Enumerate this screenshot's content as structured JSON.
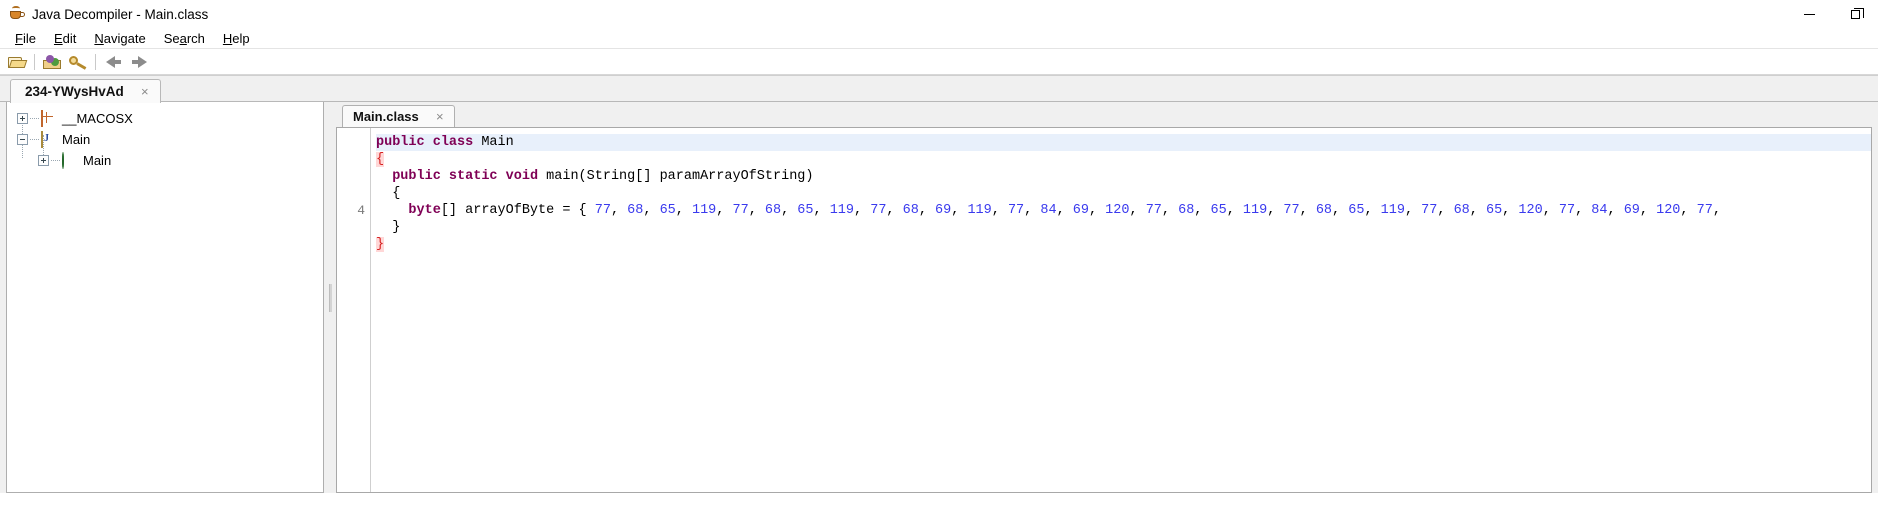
{
  "window": {
    "title": "Java Decompiler - Main.class",
    "icon": "java-cup-icon",
    "controls": {
      "minimize": "minimize-button",
      "maximize": "restore-button"
    }
  },
  "menubar": {
    "items": [
      {
        "label": "File",
        "mnemonic": "F"
      },
      {
        "label": "Edit",
        "mnemonic": "E"
      },
      {
        "label": "Navigate",
        "mnemonic": "N"
      },
      {
        "label": "Search",
        "mnemonic": "a"
      },
      {
        "label": "Help",
        "mnemonic": "H"
      }
    ]
  },
  "toolbar": {
    "buttons": [
      {
        "name": "open-file-button",
        "icon": "open-folder-icon"
      },
      {
        "name": "open-type-button",
        "icon": "package-icon"
      },
      {
        "name": "search-button",
        "icon": "key-icon"
      },
      {
        "name": "navigate-back-button",
        "icon": "arrow-left-icon"
      },
      {
        "name": "navigate-forward-button",
        "icon": "arrow-right-icon"
      }
    ]
  },
  "project_tabs": [
    {
      "label": "234-YWysHvAd",
      "active": true,
      "close": "×"
    }
  ],
  "tree": {
    "nodes": [
      {
        "label": "__MACOSX",
        "icon": "package-grid-icon",
        "expanded": false,
        "toggle": "+",
        "depth": 0
      },
      {
        "label": "Main",
        "icon": "java-file-icon",
        "expanded": true,
        "toggle": "−",
        "depth": 0
      },
      {
        "label": "Main",
        "icon": "java-class-icon",
        "expanded": false,
        "toggle": "+",
        "depth": 1
      }
    ]
  },
  "editor": {
    "tabs": [
      {
        "label": "Main.class",
        "active": true,
        "close": "×"
      }
    ],
    "gutter": [
      "",
      "",
      "",
      "",
      "4",
      "",
      ""
    ],
    "code_lines": [
      {
        "current": true,
        "tokens": [
          {
            "t": "public",
            "c": "kw"
          },
          {
            "t": " ",
            "c": "plain"
          },
          {
            "t": "class",
            "c": "kw"
          },
          {
            "t": " Main",
            "c": "plain"
          }
        ]
      },
      {
        "current": false,
        "tokens": [
          {
            "t": "{",
            "c": "brace-hl"
          }
        ]
      },
      {
        "current": false,
        "tokens": [
          {
            "t": "  ",
            "c": "plain"
          },
          {
            "t": "public",
            "c": "kw"
          },
          {
            "t": " ",
            "c": "plain"
          },
          {
            "t": "static",
            "c": "kw"
          },
          {
            "t": " ",
            "c": "plain"
          },
          {
            "t": "void",
            "c": "kw"
          },
          {
            "t": " main(String[] paramArrayOfString)",
            "c": "plain"
          }
        ]
      },
      {
        "current": false,
        "tokens": [
          {
            "t": "  {",
            "c": "plain"
          }
        ]
      },
      {
        "current": false,
        "tokens": [
          {
            "t": "    ",
            "c": "plain"
          },
          {
            "t": "byte",
            "c": "kw"
          },
          {
            "t": "[] arrayOfByte = { ",
            "c": "plain"
          },
          {
            "t": "77",
            "c": "num"
          },
          {
            "t": ", ",
            "c": "plain"
          },
          {
            "t": "68",
            "c": "num"
          },
          {
            "t": ", ",
            "c": "plain"
          },
          {
            "t": "65",
            "c": "num"
          },
          {
            "t": ", ",
            "c": "plain"
          },
          {
            "t": "119",
            "c": "num"
          },
          {
            "t": ", ",
            "c": "plain"
          },
          {
            "t": "77",
            "c": "num"
          },
          {
            "t": ", ",
            "c": "plain"
          },
          {
            "t": "68",
            "c": "num"
          },
          {
            "t": ", ",
            "c": "plain"
          },
          {
            "t": "65",
            "c": "num"
          },
          {
            "t": ", ",
            "c": "plain"
          },
          {
            "t": "119",
            "c": "num"
          },
          {
            "t": ", ",
            "c": "plain"
          },
          {
            "t": "77",
            "c": "num"
          },
          {
            "t": ", ",
            "c": "plain"
          },
          {
            "t": "68",
            "c": "num"
          },
          {
            "t": ", ",
            "c": "plain"
          },
          {
            "t": "69",
            "c": "num"
          },
          {
            "t": ", ",
            "c": "plain"
          },
          {
            "t": "119",
            "c": "num"
          },
          {
            "t": ", ",
            "c": "plain"
          },
          {
            "t": "77",
            "c": "num"
          },
          {
            "t": ", ",
            "c": "plain"
          },
          {
            "t": "84",
            "c": "num"
          },
          {
            "t": ", ",
            "c": "plain"
          },
          {
            "t": "69",
            "c": "num"
          },
          {
            "t": ", ",
            "c": "plain"
          },
          {
            "t": "120",
            "c": "num"
          },
          {
            "t": ", ",
            "c": "plain"
          },
          {
            "t": "77",
            "c": "num"
          },
          {
            "t": ", ",
            "c": "plain"
          },
          {
            "t": "68",
            "c": "num"
          },
          {
            "t": ", ",
            "c": "plain"
          },
          {
            "t": "65",
            "c": "num"
          },
          {
            "t": ", ",
            "c": "plain"
          },
          {
            "t": "119",
            "c": "num"
          },
          {
            "t": ", ",
            "c": "plain"
          },
          {
            "t": "77",
            "c": "num"
          },
          {
            "t": ", ",
            "c": "plain"
          },
          {
            "t": "68",
            "c": "num"
          },
          {
            "t": ", ",
            "c": "plain"
          },
          {
            "t": "65",
            "c": "num"
          },
          {
            "t": ", ",
            "c": "plain"
          },
          {
            "t": "119",
            "c": "num"
          },
          {
            "t": ", ",
            "c": "plain"
          },
          {
            "t": "77",
            "c": "num"
          },
          {
            "t": ", ",
            "c": "plain"
          },
          {
            "t": "68",
            "c": "num"
          },
          {
            "t": ", ",
            "c": "plain"
          },
          {
            "t": "65",
            "c": "num"
          },
          {
            "t": ", ",
            "c": "plain"
          },
          {
            "t": "120",
            "c": "num"
          },
          {
            "t": ", ",
            "c": "plain"
          },
          {
            "t": "77",
            "c": "num"
          },
          {
            "t": ", ",
            "c": "plain"
          },
          {
            "t": "84",
            "c": "num"
          },
          {
            "t": ", ",
            "c": "plain"
          },
          {
            "t": "69",
            "c": "num"
          },
          {
            "t": ", ",
            "c": "plain"
          },
          {
            "t": "120",
            "c": "num"
          },
          {
            "t": ", ",
            "c": "plain"
          },
          {
            "t": "77",
            "c": "num"
          },
          {
            "t": ",",
            "c": "plain"
          }
        ]
      },
      {
        "current": false,
        "tokens": [
          {
            "t": "  }",
            "c": "plain"
          }
        ]
      },
      {
        "current": false,
        "tokens": [
          {
            "t": "}",
            "c": "brace-hl"
          }
        ]
      }
    ]
  },
  "colors": {
    "keyword": "#7f0055",
    "number": "#3a3aee",
    "brace_highlight_bg": "#ffd7d7",
    "brace_highlight_fg": "#d62020",
    "current_line_bg": "#e8f0fb",
    "chrome_bg": "#f0f0f0"
  }
}
